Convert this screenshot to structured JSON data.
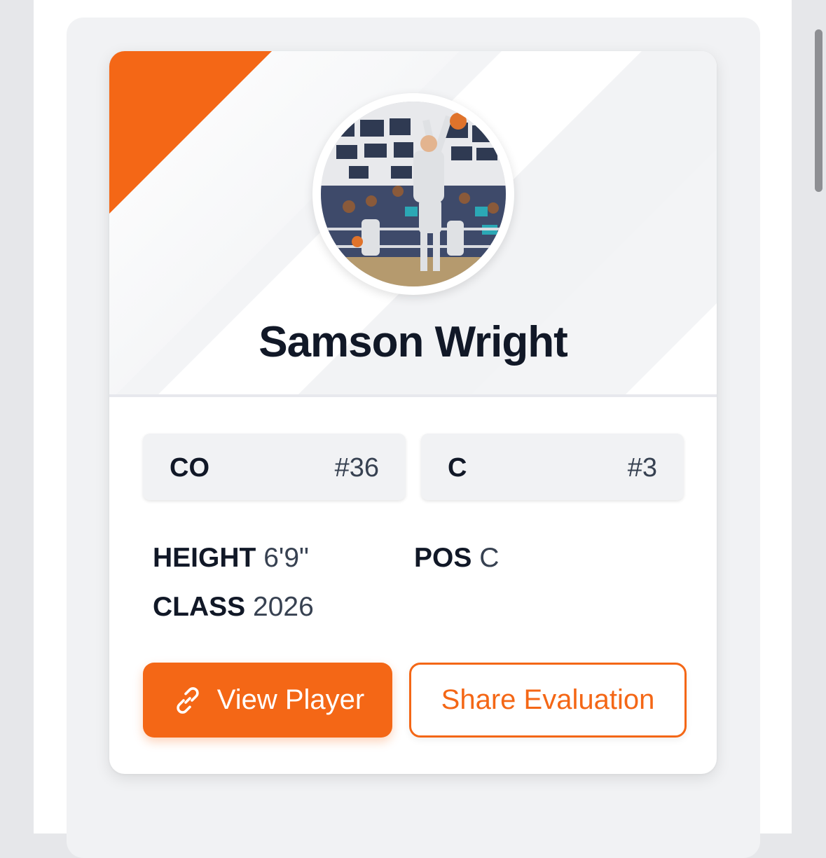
{
  "player": {
    "name": "Samson Wright",
    "photo_alt": "Player dunking a basketball",
    "photo_icon": "basketball-dunk-photo"
  },
  "rankings": [
    {
      "label": "CO",
      "value": "#36"
    },
    {
      "label": "C",
      "value": "#3"
    }
  ],
  "attributes": {
    "height": {
      "label": "HEIGHT",
      "value": "6'9\""
    },
    "pos": {
      "label": "POS",
      "value": "C"
    },
    "class": {
      "label": "CLASS",
      "value": "2026"
    }
  },
  "actions": {
    "view_player": "View Player",
    "view_player_icon": "link-icon",
    "share_evaluation": "Share Evaluation"
  },
  "colors": {
    "accent": "#f46716",
    "text_dark": "#111827",
    "panel": "#f1f2f4"
  }
}
